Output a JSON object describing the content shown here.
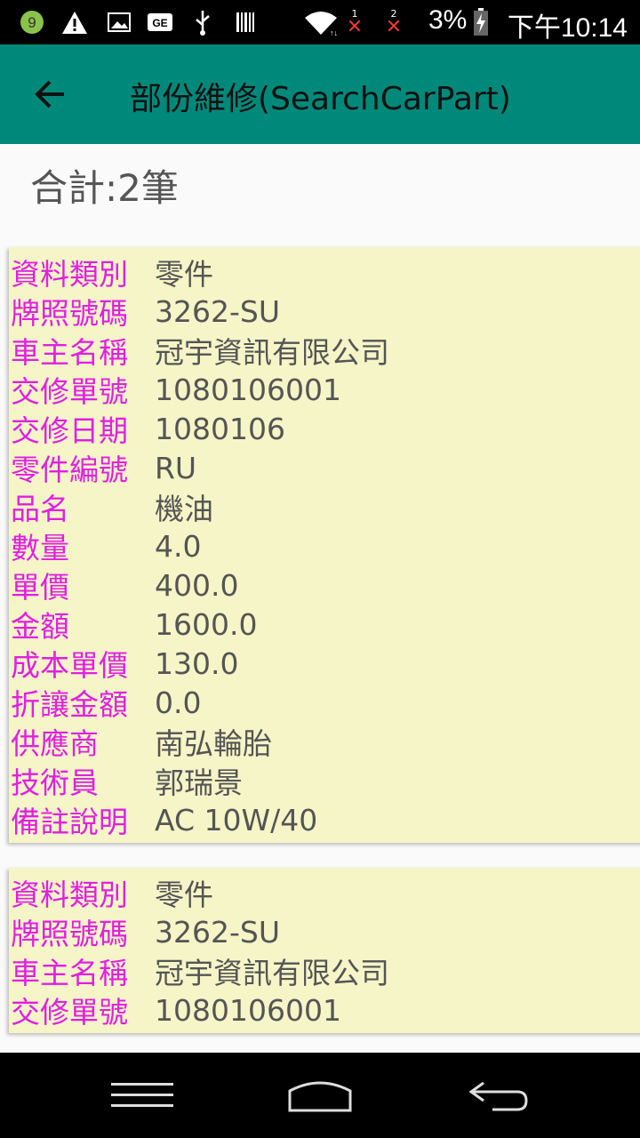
{
  "status_bar": {
    "notification_badge": "9",
    "battery_percent": "3%",
    "sim1": "1",
    "sim2": "2",
    "time": "下午10:14"
  },
  "app_bar": {
    "title": "部份維修(SearchCarPart)"
  },
  "summary": {
    "total_text": "合計:2筆"
  },
  "records": [
    {
      "fields": [
        {
          "label": "資料類別",
          "value": "零件"
        },
        {
          "label": "牌照號碼",
          "value": "3262-SU"
        },
        {
          "label": "車主名稱",
          "value": "冠宇資訊有限公司"
        },
        {
          "label": "交修單號",
          "value": "1080106001"
        },
        {
          "label": "交修日期",
          "value": "1080106"
        },
        {
          "label": "零件編號",
          "value": "RU"
        },
        {
          "label": "品名",
          "value": "機油"
        },
        {
          "label": "數量",
          "value": "4.0"
        },
        {
          "label": "單價",
          "value": "400.0"
        },
        {
          "label": "金額",
          "value": "1600.0"
        },
        {
          "label": "成本單價",
          "value": "130.0"
        },
        {
          "label": "折讓金額",
          "value": "0.0"
        },
        {
          "label": "供應商",
          "value": "南弘輪胎"
        },
        {
          "label": "技術員",
          "value": "郭瑞景"
        },
        {
          "label": "備註說明",
          "value": "AC 10W/40"
        }
      ]
    },
    {
      "fields": [
        {
          "label": "資料類別",
          "value": "零件"
        },
        {
          "label": "牌照號碼",
          "value": "3262-SU"
        },
        {
          "label": "車主名稱",
          "value": "冠宇資訊有限公司"
        },
        {
          "label": "交修單號",
          "value": "1080106001"
        }
      ]
    }
  ],
  "colors": {
    "app_bar": "#00897b",
    "label": "#e020e0",
    "card_bg": "#f5f5c8"
  }
}
